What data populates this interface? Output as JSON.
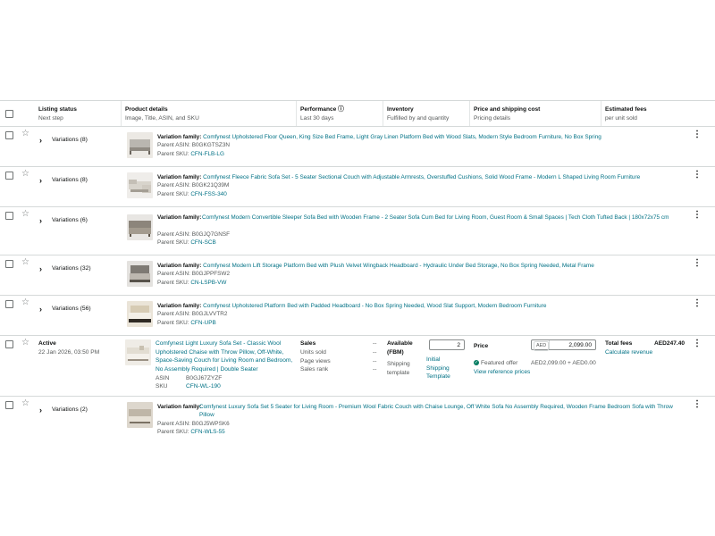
{
  "header": {
    "listing_status": {
      "title": "Listing status",
      "sub": "Next step"
    },
    "product_details": {
      "title": "Product details",
      "sub": "Image, Title, ASIN, and SKU"
    },
    "performance": {
      "title": "Performance ⓘ",
      "sub": "Last 30 days"
    },
    "inventory": {
      "title": "Inventory",
      "sub": "Fulfilled by and quantity"
    },
    "price": {
      "title": "Price and shipping cost",
      "sub": "Pricing details"
    },
    "fees": {
      "title": "Estimated fees",
      "sub": "per unit sold"
    }
  },
  "labels": {
    "variation_family": "Variation family:",
    "parent_asin": "Parent ASIN:",
    "parent_sku": "Parent SKU:",
    "kebab": "⋮"
  },
  "rows": [
    {
      "variations": "Variations (8)",
      "title": "Comfynest Upholstered Floor Queen, King Size Bed Frame, Light Gray Linen Platform Bed with Wood Slats, Modern Style Bedroom Furniture, No Box Spring",
      "asin": "B0GKGTSZ3N",
      "sku": "CFN-FLB-LG"
    },
    {
      "variations": "Variations (8)",
      "title": "Comfynest Fleece Fabric Sofa Set - 5 Seater Sectional Couch with Adjustable Armrests, Overstuffed Cushions, Solid Wood Frame - Modern L Shaped Living Room Furniture",
      "asin": "B0GK21Q39M",
      "sku": "CFN-FSS-340"
    },
    {
      "variations": "Variations (6)",
      "title": "Comfynest Modern Convertible Sleeper Sofa Bed with Wooden Frame - 2 Seater Sofa Cum Bed for Living Room, Guest Room & Small Spaces | Tech Cloth Tufted Back | 180x72x75 cm",
      "asin": "B0GJQ7GNSF",
      "sku": "CFN-SCB"
    },
    {
      "variations": "Variations (32)",
      "title": "Comfynest Modern Lift Storage Platform Bed with Plush Velvet Wingback Headboard - Hydraulic Under Bed Storage, No Box Spring Needed, Metal Frame",
      "asin": "B0GJPPFSW2",
      "sku": "CN-LSPB-VW"
    },
    {
      "variations": "Variations (56)",
      "title": "Comfynest Upholstered Platform Bed with Padded Headboard - No Box Spring Needed, Wood Slat Support, Modern Bedroom Furniture",
      "asin": "B0GJLVVTR2",
      "sku": "CFN-UPB"
    }
  ],
  "active_row": {
    "status": "Active",
    "date": "22 Jan 2026, 03:50 PM",
    "title": "Comfynest Light Luxury Sofa Set - Classic Wool Upholstered Chaise with Throw Pillow, Off-White, Space-Saving Couch for Living Room and Bedroom, No Assembly Required | Double Seater",
    "asin_label": "ASIN",
    "asin": "B0GJ67ZYZF",
    "sku_label": "SKU",
    "sku": "CFN-WL-190",
    "sales_title": "Sales",
    "units_sold": "Units sold",
    "page_views": "Page views",
    "sales_rank": "Sales rank",
    "dash": "--",
    "available_title": "Available",
    "fbm": "(FBM)",
    "quantity": "2",
    "shipping_template_label": "Shipping template",
    "shipping_template_value": "Initial Shipping Template",
    "price_title": "Price",
    "currency": "AED",
    "price": "2,099.00",
    "featured_offer": "Featured offer",
    "featured_value": "AED2,099.00 + AED0.00",
    "view_reference": "View reference prices",
    "total_fees_label": "Total fees",
    "total_fees": "AED247.40",
    "calculate_revenue": "Calculate revenue"
  },
  "last_row": {
    "variations": "Variations (2)",
    "title": "Comfynest Luxury Sofa Set 5 Seater for Living Room - Premium Wool Fabric Couch with Chaise Lounge, Off White Sofa No Assembly Required, Wooden Frame Bedroom Sofa with Throw Pillow",
    "asin": "B0GJ5WPSK6",
    "sku": "CFN-WLS-55"
  },
  "colors": {
    "link": "#007185",
    "text": "#0f1111",
    "muted": "#565959",
    "border": "#d5d9d9",
    "success": "#067d62"
  }
}
